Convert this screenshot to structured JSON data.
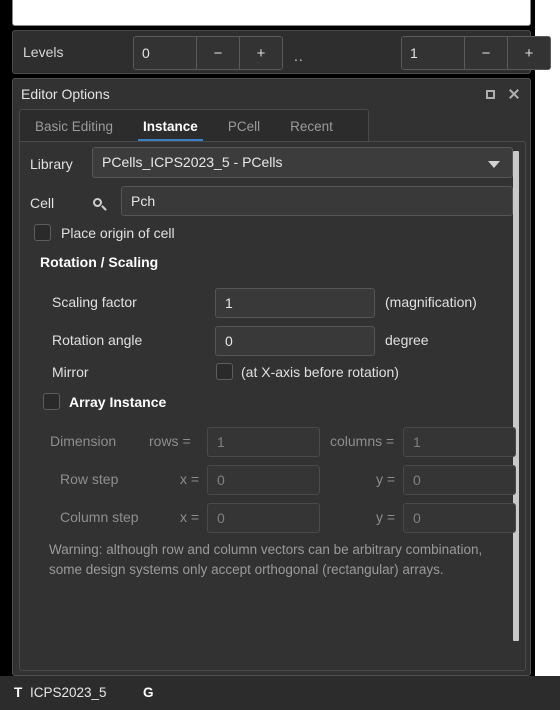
{
  "toolbar": {
    "levels_label": "Levels",
    "range_separator": "..",
    "level_from": {
      "value": "0",
      "minus": "−",
      "plus": "+"
    },
    "level_to": {
      "value": "1",
      "minus": "−",
      "plus": "+"
    }
  },
  "panel": {
    "title": "Editor Options",
    "float_icon": "float-icon",
    "close_icon": "close-icon",
    "tabs": [
      {
        "label": "Basic Editing",
        "active": false
      },
      {
        "label": "Instance",
        "active": true
      },
      {
        "label": "PCell",
        "active": false
      },
      {
        "label": "Recent",
        "active": false
      }
    ],
    "accent_color": "#3c80c8"
  },
  "form": {
    "library_label": "Library",
    "library_value": "PCells_ICPS2023_5 - PCells",
    "cell_label": "Cell",
    "cell_search_icon": "magnifier-icon",
    "cell_value": "Pch",
    "place_origin_label": "Place origin of cell",
    "place_origin_checked": false,
    "rotation_section": "Rotation / Scaling",
    "scaling_factor_label": "Scaling factor",
    "scaling_factor_value": "1",
    "scaling_factor_unit": "(magnification)",
    "rotation_angle_label": "Rotation angle",
    "rotation_angle_value": "0",
    "rotation_angle_unit": "degree",
    "mirror_label": "Mirror",
    "mirror_checked": false,
    "mirror_hint": "(at X-axis before rotation)",
    "array_instance_label": "Array Instance",
    "array_instance_checked": false,
    "dimension_label": "Dimension",
    "rows_label": "rows =",
    "rows_value": "1",
    "columns_label": "columns =",
    "columns_value": "1",
    "row_step_label": "Row step",
    "row_step_x_label": "x =",
    "row_step_x_value": "0",
    "row_step_y_label": "y =",
    "row_step_y_value": "0",
    "column_step_label": "Column step",
    "column_step_x_label": "x =",
    "column_step_x_value": "0",
    "column_step_y_label": "y =",
    "column_step_y_value": "0",
    "warning": "Warning: although row and column vectors can be arbitrary combination, some design systems only accept orthogonal (rectangular) arrays."
  },
  "statusbar": {
    "tech_prefix": "T",
    "tech_name": "ICPS2023_5",
    "grid_indicator": "G"
  }
}
